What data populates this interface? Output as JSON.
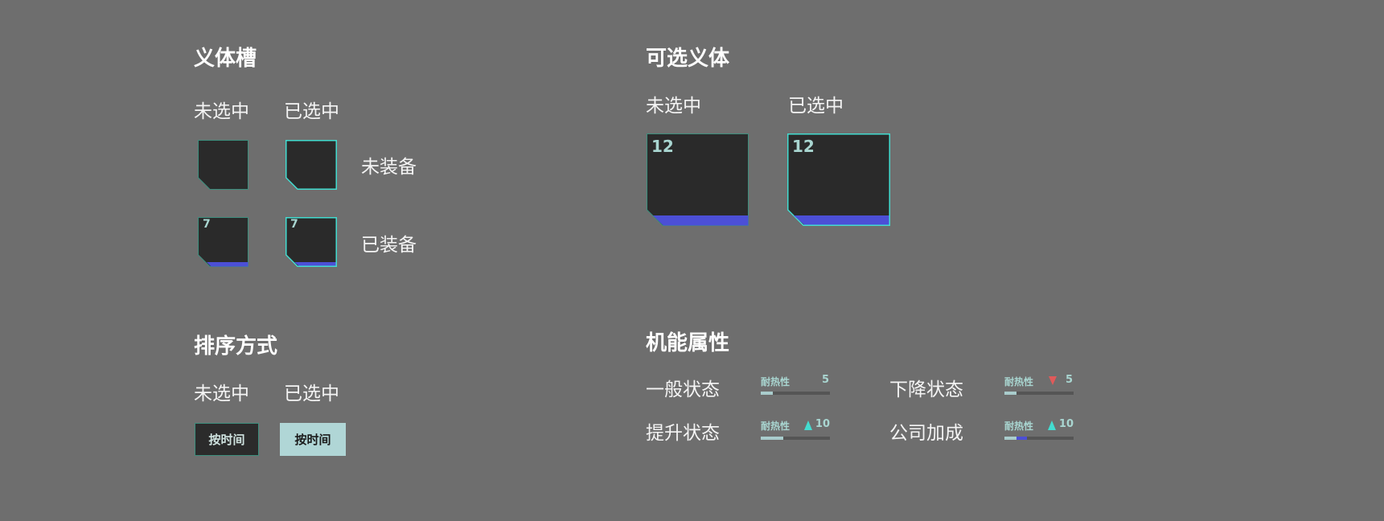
{
  "sections": {
    "slots": {
      "title": "义体槽",
      "col_unselected": "未选中",
      "col_selected": "已选中",
      "row_unequipped": "未装备",
      "row_equipped": "已装备",
      "equipped_number": "7"
    },
    "optional": {
      "title": "可选义体",
      "col_unselected": "未选中",
      "col_selected": "已选中",
      "number": "12"
    },
    "sort": {
      "title": "排序方式",
      "col_unselected": "未选中",
      "col_selected": "已选中",
      "button_label": "按时间"
    },
    "attributes": {
      "title": "机能属性",
      "states": [
        {
          "name": "一般状态",
          "stat": "耐热性",
          "value": "5",
          "trend": "none",
          "level": 0.18
        },
        {
          "name": "下降状态",
          "stat": "耐热性",
          "value": "5",
          "trend": "down",
          "level": 0.18
        },
        {
          "name": "提升状态",
          "stat": "耐热性",
          "value": "10",
          "trend": "up",
          "level": 0.32
        },
        {
          "name": "公司加成",
          "stat": "耐热性",
          "value": "10",
          "trend": "up",
          "level": 0.18,
          "bonus_level": 0.15
        }
      ]
    }
  },
  "colors": {
    "background": "#6e6e6e",
    "tile": "#2a2a2a",
    "border_unselected": "#3c8e7d",
    "border_selected": "#43dcd0",
    "equipped_bar": "#4c4fd6",
    "text_accent": "#a9d6d1",
    "arrow_up": "#43dcd0",
    "arrow_down": "#e05a5a"
  }
}
